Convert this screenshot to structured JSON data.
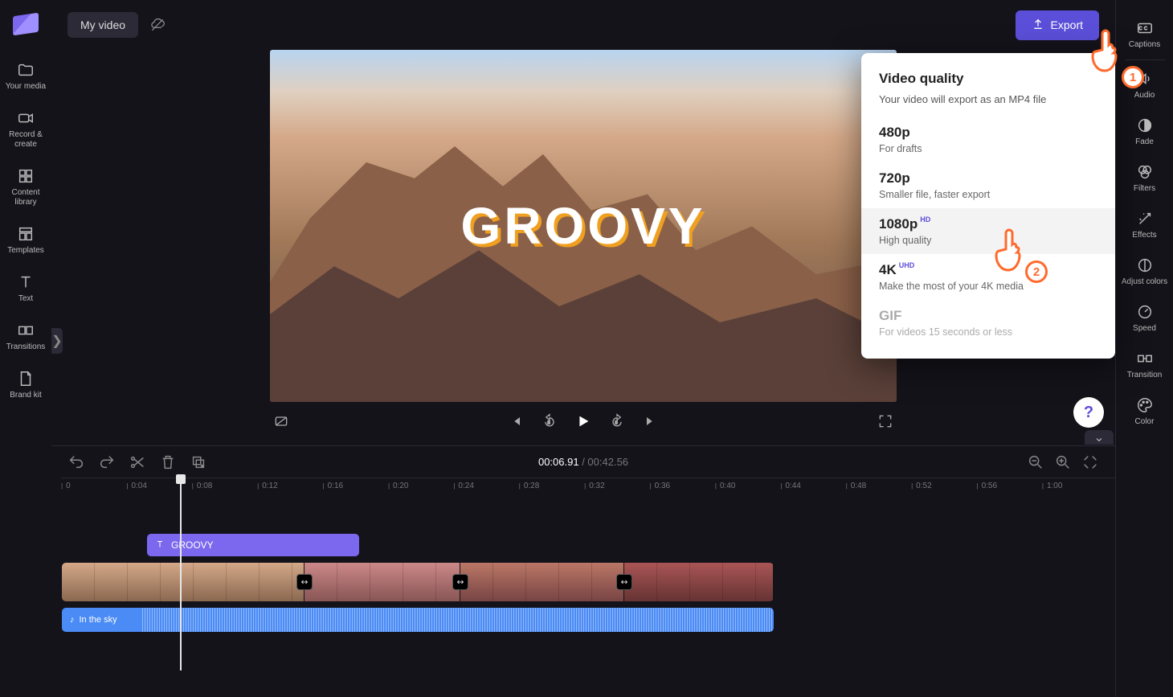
{
  "header": {
    "project_title": "My video",
    "export_label": "Export"
  },
  "left_nav": [
    {
      "label": "Your media",
      "icon": "folder"
    },
    {
      "label": "Record & create",
      "icon": "camera"
    },
    {
      "label": "Content library",
      "icon": "library"
    },
    {
      "label": "Templates",
      "icon": "templates"
    },
    {
      "label": "Text",
      "icon": "text"
    },
    {
      "label": "Transitions",
      "icon": "transitions"
    },
    {
      "label": "Brand kit",
      "icon": "brandkit"
    }
  ],
  "right_nav": [
    {
      "label": "Captions",
      "icon": "cc"
    },
    {
      "label": "Audio",
      "icon": "audio"
    },
    {
      "label": "Fade",
      "icon": "fade"
    },
    {
      "label": "Filters",
      "icon": "filters"
    },
    {
      "label": "Effects",
      "icon": "effects"
    },
    {
      "label": "Adjust colors",
      "icon": "adjust"
    },
    {
      "label": "Speed",
      "icon": "speed"
    },
    {
      "label": "Transition",
      "icon": "transition"
    },
    {
      "label": "Color",
      "icon": "palette"
    }
  ],
  "preview": {
    "overlay_text": "GROOVY"
  },
  "timeline": {
    "current_time": "00:06.91",
    "total_time": "00:42.56",
    "ruler_marks": [
      "0",
      "0:04",
      "0:08",
      "0:12",
      "0:16",
      "0:20",
      "0:24",
      "0:28",
      "0:32",
      "0:36",
      "0:40",
      "0:44",
      "0:48",
      "0:52",
      "0:56",
      "1:00"
    ],
    "text_clip_label": "GROOVY",
    "audio_clip_label": "In the sky"
  },
  "export_popup": {
    "title": "Video quality",
    "subtitle": "Your video will export as an MP4 file",
    "options": [
      {
        "label": "480p",
        "badge": "",
        "desc": "For drafts"
      },
      {
        "label": "720p",
        "badge": "",
        "desc": "Smaller file, faster export"
      },
      {
        "label": "1080p",
        "badge": "HD",
        "desc": "High quality"
      },
      {
        "label": "4K",
        "badge": "UHD",
        "desc": "Make the most of your 4K media"
      },
      {
        "label": "GIF",
        "badge": "",
        "desc": "For videos 15 seconds or less"
      }
    ]
  },
  "annotations": {
    "pointer1": "1",
    "pointer2": "2"
  },
  "help_glyph": "?"
}
